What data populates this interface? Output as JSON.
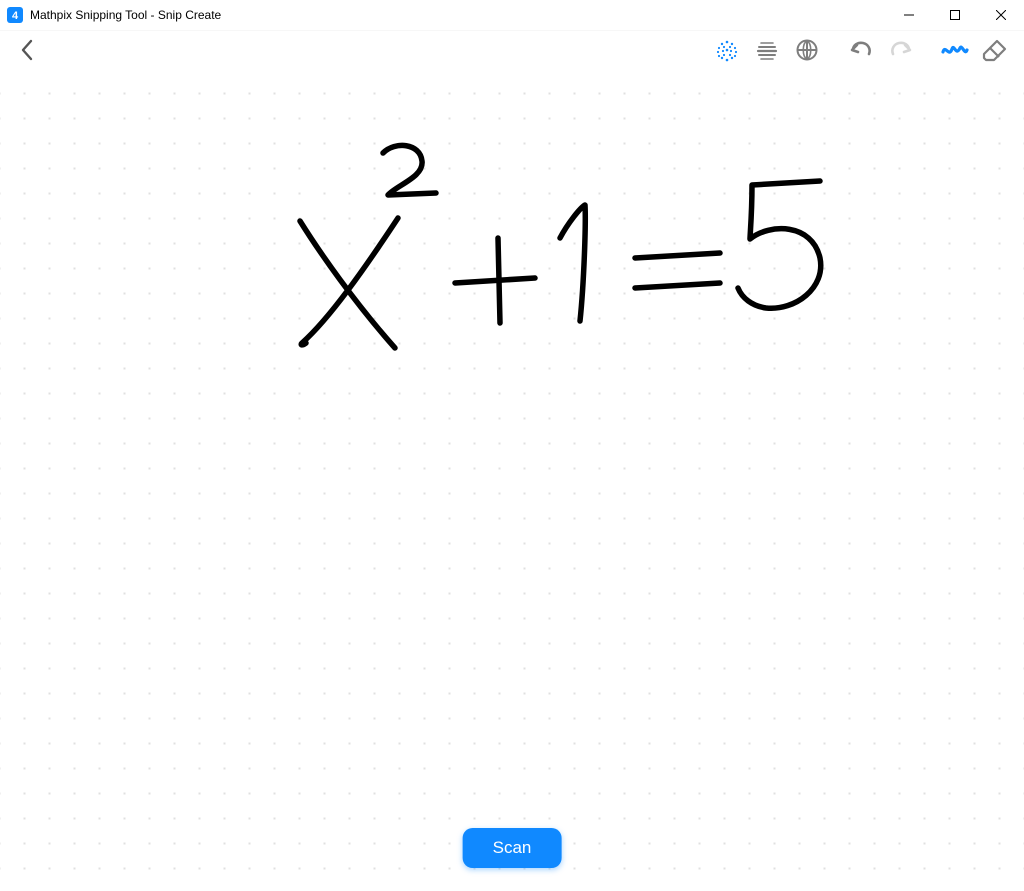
{
  "window": {
    "title": "Mathpix Snipping Tool - Snip Create",
    "app_icon_letter": "4"
  },
  "toolbar": {
    "back_label": "Back",
    "grid_dot_label": "Dot grid",
    "grid_lines_label": "Line grid",
    "grid_squares_label": "Square grid",
    "undo_label": "Undo",
    "redo_label": "Redo",
    "pen_label": "Pen",
    "eraser_label": "Eraser"
  },
  "canvas": {
    "background": "dot",
    "active_tool": "pen",
    "handwritten_expression": "X^2 + 1 = 5"
  },
  "actions": {
    "scan_label": "Scan"
  },
  "colors": {
    "accent": "#1089FF",
    "icon_inactive": "#7e7e7e",
    "stroke": "#000000"
  }
}
